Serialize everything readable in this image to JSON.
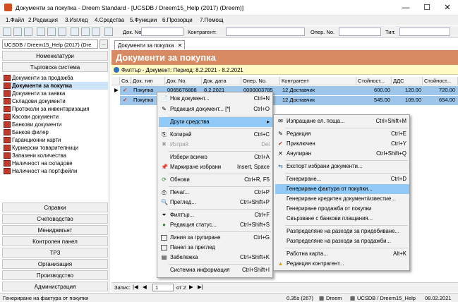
{
  "window": {
    "title": "Документи за покупка - Dreem Standard - [UCSDB / Dreem15_Help (2017) (Dreem)]",
    "min": "—",
    "max": "☐",
    "close": "✕"
  },
  "menubar": [
    "1.Файл",
    "2.Редакция",
    "3.Изглед",
    "4.Средства",
    "5.Функции",
    "6.Прозорци",
    "7.Помощ"
  ],
  "toolbar": {
    "doc_no_label": "Док. No.",
    "contractor_label": "Контрагент:",
    "oper_no_label": "Опер. No.",
    "type_label": "Тип:"
  },
  "left": {
    "db_select": "UCSDB / Dreem15_Help (2017) (Dre",
    "db_button": "...",
    "groups_top": [
      "Номенклатури",
      "Търговска система"
    ],
    "items": [
      "Документи за продажба",
      "Документи за покупка",
      "Документи за заявка",
      "Складови документи",
      "Протоколи за инвентаризация",
      "Касови документи",
      "Банкови документи",
      "Банков филер",
      "Гаранционни карти",
      "Куриерски товарителници",
      "Запазени количества",
      "Наличност на складове",
      "Наличност на портфейли"
    ],
    "groups_bottom": [
      "Справки",
      "Счетоводство",
      "Мениджмънт",
      "Контролен панел",
      "ТРЗ",
      "Организация",
      "Производство",
      "Администрация"
    ]
  },
  "main": {
    "tab": "Документи за покупка",
    "tab_close": "✕",
    "header": "Документи за покупка",
    "filter": "Филтър - Документ: Период: 8.2.2021 - 8.2.2021",
    "columns": [
      "Св...",
      "Док. тип",
      "Док. No.",
      "Док. дата",
      "Опер. No.",
      "Контрагент",
      "Стойност...",
      "ДДС",
      "Стойност..."
    ],
    "rows": [
      {
        "type": "Покупка",
        "no": "0065676888",
        "date": "8.2.2021",
        "oper": "0000003785",
        "contractor": "12 Доставчик",
        "value": "600.00",
        "vat": "120.00",
        "total": "720.00"
      },
      {
        "type": "Покупка",
        "no": "",
        "date": "",
        "oper": "",
        "contractor": "12 Доставчик",
        "value": "545.00",
        "vat": "109.00",
        "total": "654.00"
      }
    ],
    "pager": {
      "label": "Запис:",
      "current": "1",
      "of": "от 2"
    }
  },
  "context_menu": [
    {
      "label": "Нов документ...",
      "shortcut": "Ctrl+N",
      "icon": "new-doc-icon"
    },
    {
      "label": "Редакция документ... [*]",
      "shortcut": "Ctrl+O",
      "icon": "edit-doc-icon"
    },
    {
      "label": "Други средства",
      "shortcut": "▸",
      "icon": ""
    },
    {
      "label": "Копирай",
      "shortcut": "Ctrl+C",
      "icon": "copy-icon"
    },
    {
      "label": "Изтрий",
      "shortcut": "Del",
      "icon": "delete-icon"
    },
    {
      "label": "Избери всичко",
      "shortcut": "Ctrl+A",
      "icon": ""
    },
    {
      "label": "Маркиране избрани",
      "shortcut": "Insert, Space",
      "icon": "pin-icon"
    },
    {
      "label": "Обнови",
      "shortcut": "Ctrl+R, F5",
      "icon": "refresh-icon"
    },
    {
      "label": "Печат...",
      "shortcut": "Ctrl+P",
      "icon": "print-icon"
    },
    {
      "label": "Преглед...",
      "shortcut": "Ctrl+Shift+P",
      "icon": "preview-icon"
    },
    {
      "label": "Филтър...",
      "shortcut": "Ctrl+F",
      "icon": "filter-icon"
    },
    {
      "label": "Редакция статус...",
      "shortcut": "Ctrl+Shift+S",
      "icon": "status-icon"
    },
    {
      "label": "Линия за групиране",
      "shortcut": "Ctrl+G",
      "icon": ""
    },
    {
      "label": "Панел за преглед",
      "shortcut": "",
      "icon": ""
    },
    {
      "label": "Забележка",
      "shortcut": "Ctrl+Shift+K",
      "icon": "note-icon"
    },
    {
      "label": "Системна информация",
      "shortcut": "Ctrl+Shift+I",
      "icon": ""
    }
  ],
  "submenu": [
    {
      "label": "Изпращане ел. поща...",
      "shortcut": "Ctrl+Shift+M",
      "icon": "mail-icon"
    },
    {
      "label": "Редакция",
      "shortcut": "Ctrl+E",
      "icon": "edit-icon"
    },
    {
      "label": "Приключен",
      "shortcut": "Ctrl+Y",
      "icon": "check-icon"
    },
    {
      "label": "Анулиран",
      "shortcut": "Ctrl+Shift+Q",
      "icon": "cancel-icon"
    },
    {
      "label": "Експорт избрани документи...",
      "shortcut": "",
      "icon": "export-icon"
    },
    {
      "label": "Генериране...",
      "shortcut": "Ctrl+D",
      "icon": ""
    },
    {
      "label": "Генериране фактура от покупки...",
      "shortcut": "",
      "icon": ""
    },
    {
      "label": "Генериране кредитен документ/известие...",
      "shortcut": "",
      "icon": ""
    },
    {
      "label": "Генериране продажба от покупки",
      "shortcut": "",
      "icon": ""
    },
    {
      "label": "Свързване с банкови плащания...",
      "shortcut": "",
      "icon": ""
    },
    {
      "label": "Разпределяне на разходи за придобиване...",
      "shortcut": "",
      "icon": ""
    },
    {
      "label": "Разпределяне на разходи за продажби...",
      "shortcut": "",
      "icon": ""
    },
    {
      "label": "Работна карта...",
      "shortcut": "Alt+K",
      "icon": ""
    },
    {
      "label": "Редакция контрагент...",
      "shortcut": "",
      "icon": "contractor-icon"
    }
  ],
  "status": {
    "left": "Генериране на фактура от покупки",
    "time": "0.35s (267)",
    "user": "Dreem",
    "db": "UCSDB / Dreem15_Help",
    "date": "08.02.2021"
  },
  "colors": {
    "header": "#d88b62",
    "highlight": "#91c9f7",
    "selected_row": "#9ec6ea",
    "filter_bg": "#fff9c4"
  }
}
